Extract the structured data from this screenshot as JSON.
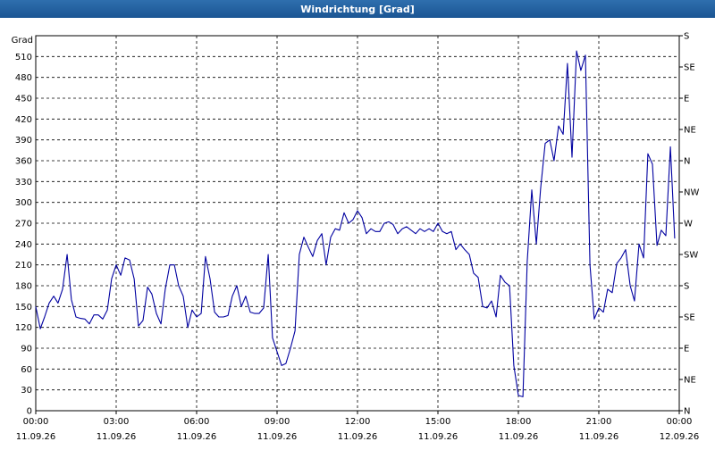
{
  "window": {
    "title": "Windrichtung [Grad]"
  },
  "chart_data": {
    "type": "line",
    "title": "Windrichtung [Grad]",
    "ylabel": "Grad",
    "xlim": [
      "11.09.26 00:00",
      "12.09.26 00:00"
    ],
    "ylim": [
      0,
      540
    ],
    "grid": true,
    "y_ticks": [
      0,
      30,
      60,
      90,
      120,
      150,
      180,
      210,
      240,
      270,
      300,
      330,
      360,
      390,
      420,
      450,
      480,
      510
    ],
    "right_axis_labels": [
      "N",
      "NE",
      "E",
      "SE",
      "S",
      "SW",
      "W",
      "NW",
      "N",
      "NE",
      "E",
      "SE",
      "S"
    ],
    "x_ticks": [
      {
        "time": "00:00",
        "date": "11.09.26",
        "hour": 0
      },
      {
        "time": "03:00",
        "date": "11.09.26",
        "hour": 3
      },
      {
        "time": "06:00",
        "date": "11.09.26",
        "hour": 6
      },
      {
        "time": "09:00",
        "date": "11.09.26",
        "hour": 9
      },
      {
        "time": "12:00",
        "date": "11.09.26",
        "hour": 12
      },
      {
        "time": "15:00",
        "date": "11.09.26",
        "hour": 15
      },
      {
        "time": "18:00",
        "date": "11.09.26",
        "hour": 18
      },
      {
        "time": "21:00",
        "date": "11.09.26",
        "hour": 21
      },
      {
        "time": "00:00",
        "date": "12.09.26",
        "hour": 24
      }
    ],
    "series": [
      {
        "color": "#0000a0",
        "x": [
          0.0,
          0.17,
          0.33,
          0.5,
          0.67,
          0.83,
          1.0,
          1.17,
          1.33,
          1.5,
          1.67,
          1.83,
          2.0,
          2.17,
          2.33,
          2.5,
          2.67,
          2.83,
          3.0,
          3.17,
          3.33,
          3.5,
          3.67,
          3.83,
          4.0,
          4.17,
          4.33,
          4.5,
          4.67,
          4.83,
          5.0,
          5.17,
          5.33,
          5.5,
          5.67,
          5.83,
          6.0,
          6.17,
          6.33,
          6.5,
          6.67,
          6.83,
          7.0,
          7.17,
          7.33,
          7.5,
          7.67,
          7.83,
          8.0,
          8.17,
          8.33,
          8.5,
          8.67,
          8.83,
          9.0,
          9.17,
          9.33,
          9.5,
          9.67,
          9.83,
          10.0,
          10.17,
          10.33,
          10.5,
          10.67,
          10.83,
          11.0,
          11.17,
          11.33,
          11.5,
          11.67,
          11.83,
          12.0,
          12.17,
          12.33,
          12.5,
          12.67,
          12.83,
          13.0,
          13.17,
          13.33,
          13.5,
          13.67,
          13.83,
          14.0,
          14.17,
          14.33,
          14.5,
          14.67,
          14.83,
          15.0,
          15.17,
          15.33,
          15.5,
          15.67,
          15.83,
          16.0,
          16.17,
          16.33,
          16.5,
          16.67,
          16.83,
          17.0,
          17.17,
          17.33,
          17.5,
          17.67,
          17.83,
          18.0,
          18.17,
          18.33,
          18.5,
          18.67,
          18.83,
          19.0,
          19.17,
          19.33,
          19.5,
          19.67,
          19.83,
          20.0,
          20.17,
          20.33,
          20.5,
          20.67,
          20.83,
          21.0,
          21.17,
          21.33,
          21.5,
          21.67,
          21.83,
          22.0,
          22.17,
          22.33,
          22.5,
          22.67,
          22.83,
          23.0,
          23.17,
          23.33,
          23.5,
          23.67,
          23.83
        ],
        "values": [
          150,
          118,
          135,
          155,
          165,
          155,
          175,
          225,
          160,
          135,
          133,
          132,
          125,
          138,
          138,
          132,
          145,
          190,
          210,
          195,
          220,
          217,
          190,
          122,
          130,
          178,
          168,
          140,
          125,
          175,
          210,
          210,
          180,
          165,
          120,
          145,
          135,
          140,
          222,
          190,
          142,
          135,
          135,
          137,
          165,
          180,
          150,
          165,
          142,
          140,
          140,
          148,
          225,
          105,
          85,
          65,
          68,
          90,
          115,
          225,
          250,
          235,
          222,
          245,
          255,
          210,
          250,
          262,
          260,
          285,
          270,
          275,
          288,
          278,
          255,
          262,
          258,
          258,
          270,
          272,
          268,
          255,
          262,
          265,
          260,
          255,
          262,
          258,
          262,
          258,
          270,
          258,
          255,
          258,
          232,
          240,
          232,
          225,
          198,
          192,
          150,
          148,
          158,
          135,
          195,
          185,
          180,
          65,
          22,
          20,
          215,
          318,
          240,
          320,
          385,
          390,
          360,
          410,
          398,
          500,
          365,
          518,
          490,
          512,
          210,
          132,
          148,
          142,
          175,
          170,
          212,
          220,
          232,
          180,
          158,
          240,
          220,
          370,
          355,
          238,
          260,
          252,
          380,
          248
        ]
      }
    ]
  }
}
